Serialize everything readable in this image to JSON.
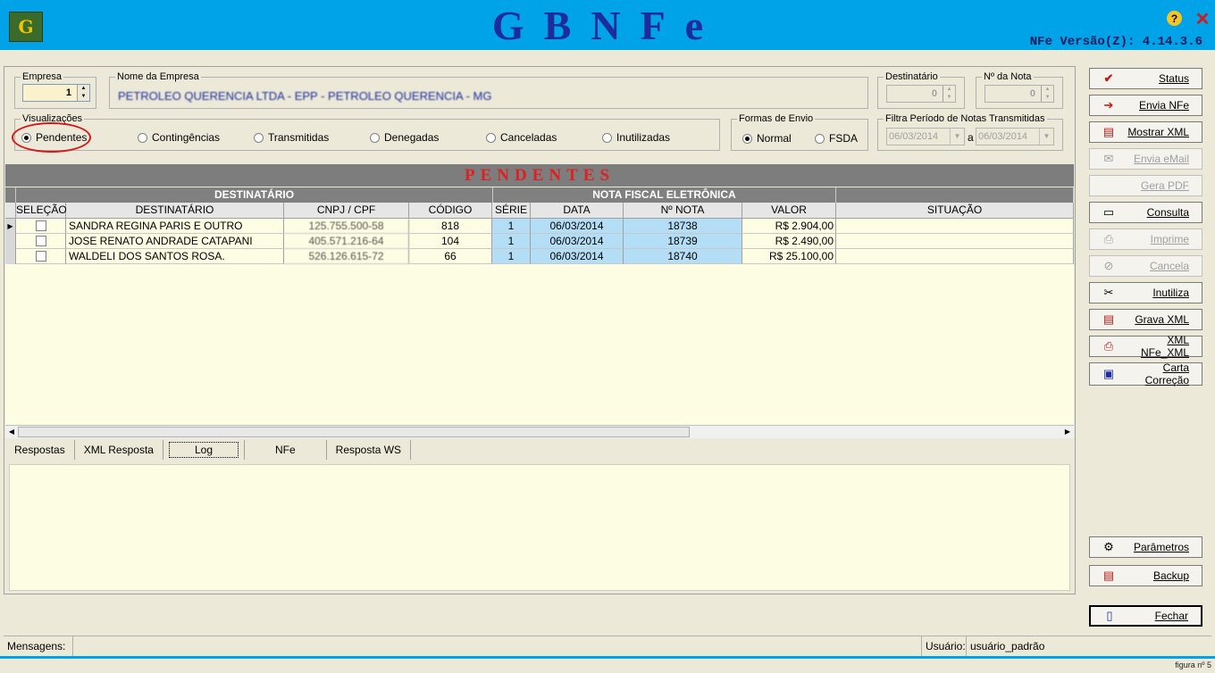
{
  "app": {
    "logo_text": "G",
    "title": "GBNFe",
    "version": "NFe Versão(Z): 4.14.3.6"
  },
  "empresa": {
    "label": "Empresa",
    "value": "1"
  },
  "nome_empresa": {
    "label": "Nome da Empresa",
    "value": "PETROLEO QUERENCIA LTDA - EPP - PETROLEO QUERENCIA - MG"
  },
  "destinatario": {
    "label": "Destinatário",
    "value": "0"
  },
  "num_nota": {
    "label": "Nº da Nota",
    "value": "0"
  },
  "visualizacoes": {
    "label": "Visualizações",
    "options": [
      "Pendentes",
      "Contingências",
      "Transmitidas",
      "Denegadas",
      "Canceladas",
      "Inutilizadas"
    ],
    "selected": "Pendentes"
  },
  "formas_envio": {
    "label": "Formas de Envio",
    "options": [
      "Normal",
      "FSDA"
    ],
    "selected": "Normal"
  },
  "periodo": {
    "label": "Filtra Período de Notas Transmitidas",
    "from": "06/03/2014",
    "sep": "a",
    "to": "06/03/2014"
  },
  "grid": {
    "title": "PENDENTES",
    "group_headers": [
      "DESTINATÁRIO",
      "NOTA FISCAL ELETRÔNICA"
    ],
    "columns": [
      "SELEÇÃO",
      "DESTINATÁRIO",
      "CNPJ / CPF",
      "CÓDIGO",
      "SÉRIE",
      "DATA",
      "Nº NOTA",
      "VALOR",
      "SITUAÇÃO"
    ],
    "rows": [
      {
        "destinatario": "SANDRA REGINA PARIS E OUTRO",
        "cnpj": "125.755.500-58",
        "codigo": "818",
        "serie": "1",
        "data": "06/03/2014",
        "nota": "18738",
        "valor": "R$ 2.904,00",
        "situacao": ""
      },
      {
        "destinatario": "JOSE RENATO ANDRADE CATAPANI",
        "cnpj": "405.571.216-64",
        "codigo": "104",
        "serie": "1",
        "data": "06/03/2014",
        "nota": "18739",
        "valor": "R$ 2.490,00",
        "situacao": ""
      },
      {
        "destinatario": "WALDELI DOS SANTOS ROSA.",
        "cnpj": "526.126.615-72",
        "codigo": "66",
        "serie": "1",
        "data": "06/03/2014",
        "nota": "18740",
        "valor": "R$ 25.100,00",
        "situacao": ""
      }
    ]
  },
  "tabs": [
    "Respostas",
    "XML Resposta",
    "Log",
    "NFe",
    "Resposta WS"
  ],
  "active_tab": "Log",
  "buttons": [
    {
      "label": "Status",
      "icon": "check-icon",
      "enabled": true
    },
    {
      "label": "Envia NFe",
      "icon": "send-icon",
      "enabled": true
    },
    {
      "label": "Mostrar XML",
      "icon": "xml-icon",
      "enabled": true
    },
    {
      "label": "Envia eMail",
      "icon": "email-icon",
      "enabled": false
    },
    {
      "label": "Gera PDF",
      "icon": "pdf-icon",
      "enabled": false
    },
    {
      "label": "Consulta",
      "icon": "query-icon",
      "enabled": true
    },
    {
      "label": "Imprime",
      "icon": "printer-icon",
      "enabled": false
    },
    {
      "label": "Cancela",
      "icon": "cancel-icon",
      "enabled": false
    },
    {
      "label": "Inutiliza",
      "icon": "tools-icon",
      "enabled": true
    },
    {
      "label": "Grava XML",
      "icon": "save-xml-icon",
      "enabled": true
    },
    {
      "label": "XML NFe_XML",
      "icon": "xml-export-icon",
      "enabled": true
    },
    {
      "label": "Carta Correção",
      "icon": "letter-icon",
      "enabled": true
    }
  ],
  "bottom_buttons": [
    {
      "label": "Parâmetros",
      "icon": "settings-icon"
    },
    {
      "label": "Backup",
      "icon": "backup-icon"
    },
    {
      "label": "Fechar",
      "icon": "door-icon"
    }
  ],
  "statusbar": {
    "mensagens_label": "Mensagens:",
    "usuario_label": "Usuário:",
    "usuario_value": "usuário_padrão"
  },
  "caption": "figura nº 5",
  "colors": {
    "titlebar": "#00a2e8",
    "title": "#1d2c9c",
    "grid_title": "#e02020",
    "grid_bg": "#fdfde3",
    "highlight": "#b4def6"
  }
}
